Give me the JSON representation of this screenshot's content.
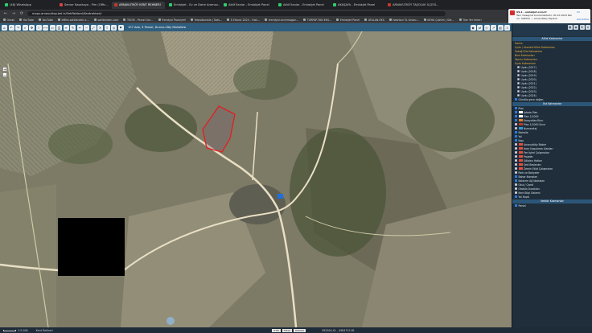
{
  "browser": {
    "tabs": [
      {
        "label": "(48) WhatsApp",
        "color": "#25d366"
      },
      {
        "label": "Server Kasakaya - Plm (Offic…",
        "color": "#d64541"
      },
      {
        "label": "ARNAVUTKÖY KENT REHBERİ",
        "color": "#c0392b",
        "active": true
      },
      {
        "label": "Emlakjet - Ev ve Daire Aramav…",
        "color": "#2ecc71"
      },
      {
        "label": "Aktif İlanlar - Emlakjet Panel",
        "color": "#2ecc71"
      },
      {
        "label": "Aktif İlanlar - Emlakjet Panel",
        "color": "#2ecc71"
      },
      {
        "label": "AKAŞAYA - Emlakjet Panel",
        "color": "#2ecc71"
      },
      {
        "label": "ARNAVUTKÖY TAŞOLUK İLÇESİ…",
        "color": "#c0392b"
      }
    ],
    "url": "maps.arnavutkoy.bel.tr/SehRehberi/Kentrehberi/",
    "bookmarks": [
      "Gmail",
      "YouTube",
      "YouTube",
      "eMite.sahibinden.c…",
      "sahibinden.com",
      "TKGM - Parsel Sor…",
      "Trendyol Pazaryeri",
      "Hepsiburada | Sats…",
      "E-Fatura 2024 - Hızlı…",
      "trendyol.com/magaz…",
      "TURPAP-TAN EKS…",
      "Emlakjet Panel",
      "ATALAN-EKS",
      "İstanbul 3L Arsası…",
      "KEHA Çözüm | Sat…",
      "Tüm Yer İmleri"
    ]
  },
  "notification": {
    "title": "VS.1 · emlakjet.com.tr",
    "body": "Yeni mesajınız bulunmaktadır. 30.12.2024 İlan no: 3L8552 — Arnavutköy Taşoluk",
    "actions": [
      "Sil",
      "Görüntüle"
    ]
  },
  "map_toolbar": {
    "location_label": "107 Ada, 3 Parsel, Durusu Köy Mahallesi",
    "tool_icons": [
      "home",
      "undo",
      "redo",
      "search",
      "pan",
      "info",
      "measure",
      "area",
      "print",
      "layers",
      "draw",
      "zoom-in",
      "zoom-out",
      "full-extent",
      "erase",
      "share",
      "camera",
      "street",
      "3d",
      "compare",
      "cad",
      "share2",
      "ruler",
      "export"
    ]
  },
  "zoom": {
    "plus": "+",
    "minus": "−"
  },
  "panel": {
    "header_altlik": "Altlık Katmanlar",
    "altlik": [
      {
        "label": "Harita",
        "kind": "lbl"
      },
      {
        "label": "Uydu / İstanbul Kilim Katmanları",
        "kind": "lbl"
      },
      {
        "label": "Sokağ Düz Katmanları",
        "kind": "lbl"
      },
      {
        "label": "Bina Katmanları",
        "kind": "lbl"
      },
      {
        "label": "Tapulu Katmanları",
        "kind": "lbl"
      },
      {
        "label": "Uydu Katmanları",
        "kind": "lbl"
      }
    ],
    "years": [
      "Uydu (2017)",
      "Uydu (2018)",
      "Uydu (2019)",
      "Uydu (2020)",
      "Uydu (2021)",
      "Uydu (2022)",
      "Uydu (2023)",
      "Uydu (2024)"
    ],
    "overlay_check": "Gündüz gece doğan",
    "header_ust": "Üst Katmanlar",
    "ust": [
      {
        "label": "Plan",
        "on": true,
        "color": ""
      },
      {
        "label": "Adada Plan",
        "on": true,
        "color": "#ffffff"
      },
      {
        "label": "Plan 1/1000",
        "on": true,
        "color": "#ffffff"
      },
      {
        "label": "Karayolları/Sınır",
        "on": true,
        "color": "#e67e22"
      },
      {
        "label": "Plan 1/1000 Sınırı",
        "on": false,
        "color": "#c0392b"
      },
      {
        "label": "Numarataj",
        "on": false,
        "color": "#3498db"
      },
      {
        "label": "Mahalle",
        "on": true,
        "color": ""
      },
      {
        "label": "Yol",
        "on": true,
        "color": ""
      },
      {
        "label": "Kapı",
        "on": true,
        "color": ""
      },
      {
        "label": "Arnavutköy Bakım",
        "on": false,
        "color": "#e74c3c"
      },
      {
        "label": "Imar Uygulama Alanları",
        "on": false,
        "color": "#e74c3c"
      },
      {
        "label": "Fen İşleri Çalışmaları",
        "on": false,
        "color": "#e74c3c"
      },
      {
        "label": "Projeler",
        "on": false,
        "color": "#e74c3c"
      },
      {
        "label": "Gölalan Hatları",
        "on": false,
        "color": "#e74c3c"
      },
      {
        "label": "Sert Beslenim",
        "on": false,
        "color": "#e74c3c"
      },
      {
        "label": "Zemin Etüd Çalışmaları",
        "on": false,
        "color": "#e74c3c"
      },
      {
        "label": "Park ve Bahçeler",
        "on": false,
        "color": ""
      },
      {
        "label": "Bahar Kamaları",
        "on": true,
        "color": ""
      },
      {
        "label": "Kaldırım Ağ Noktaları",
        "on": true,
        "color": ""
      },
      {
        "label": "Okul / Camii",
        "on": false,
        "color": ""
      },
      {
        "label": "Otobüs Durakları",
        "on": false,
        "color": ""
      },
      {
        "label": "Kent Bilgi Sistemi",
        "on": false,
        "color": ""
      },
      {
        "label": "Yol Kaydı",
        "on": true,
        "color": ""
      }
    ],
    "header_vektor": "Vektör Katmanlar",
    "vektor": [
      {
        "label": "Parsel",
        "on": true
      }
    ]
  },
  "status": {
    "user_label": "Kent Rehberi",
    "scale_label": "1:5.000",
    "center_buttons": [
      "UTM",
      "TM30",
      "WGS84"
    ],
    "coords": "392204.41 , 4584715.81"
  }
}
